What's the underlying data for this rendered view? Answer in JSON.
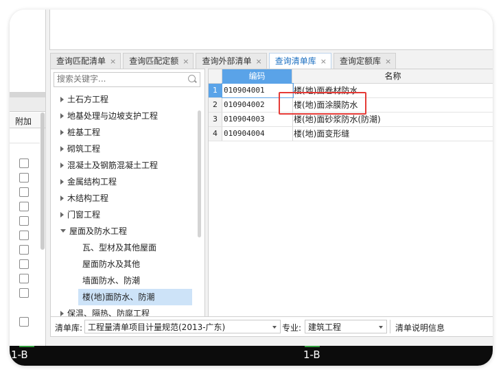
{
  "tabs": [
    {
      "label": "查询匹配清单",
      "active": false,
      "close": "×"
    },
    {
      "label": "查询匹配定额",
      "active": false,
      "close": "×"
    },
    {
      "label": "查询外部清单",
      "active": false,
      "close": "×"
    },
    {
      "label": "查询清单库",
      "active": true,
      "close": "×"
    },
    {
      "label": "查询定额库",
      "active": false,
      "close": "×"
    }
  ],
  "search": {
    "placeholder": "搜索关键字..."
  },
  "left_panel": {
    "header": "附加"
  },
  "tree": [
    {
      "label": "土石方工程",
      "level": 0,
      "expanded": false
    },
    {
      "label": "地基处理与边坡支护工程",
      "level": 0,
      "expanded": false
    },
    {
      "label": "桩基工程",
      "level": 0,
      "expanded": false
    },
    {
      "label": "砌筑工程",
      "level": 0,
      "expanded": false
    },
    {
      "label": "混凝土及钢筋混凝土工程",
      "level": 0,
      "expanded": false
    },
    {
      "label": "金属结构工程",
      "level": 0,
      "expanded": false
    },
    {
      "label": "木结构工程",
      "level": 0,
      "expanded": false
    },
    {
      "label": "门窗工程",
      "level": 0,
      "expanded": false
    },
    {
      "label": "屋面及防水工程",
      "level": 0,
      "expanded": true
    },
    {
      "label": "瓦、型材及其他屋面",
      "level": 1
    },
    {
      "label": "屋面防水及其他",
      "level": 1
    },
    {
      "label": "墙面防水、防潮",
      "level": 1
    },
    {
      "label": "楼(地)面防水、防潮",
      "level": 1,
      "selected": true
    },
    {
      "label": "保温、隔热、防腐工程",
      "level": 0,
      "expanded": false
    }
  ],
  "grid": {
    "headers": {
      "code": "编码",
      "name": "名称"
    },
    "rows": [
      {
        "num": "1",
        "code": "010904001",
        "name": "楼(地)面卷材防水"
      },
      {
        "num": "2",
        "code": "010904002",
        "name": "楼(地)面涂膜防水"
      },
      {
        "num": "3",
        "code": "010904003",
        "name": "楼(地)面砂浆防水(防潮)"
      },
      {
        "num": "4",
        "code": "010904004",
        "name": "楼(地)面变形缝"
      }
    ]
  },
  "bottom": {
    "library_label": "清单库:",
    "library_value": "工程量清单项目计量规范(2013-广东)",
    "specialty_label": "专业:",
    "specialty_value": "建筑工程",
    "info_label": "清单说明信息"
  },
  "strip": {
    "left_text": "1-B",
    "right_text": "1-B"
  },
  "colors": {
    "accent": "#5aa3e8",
    "highlight": "#e53935",
    "selected_bg": "#cde3f8"
  }
}
